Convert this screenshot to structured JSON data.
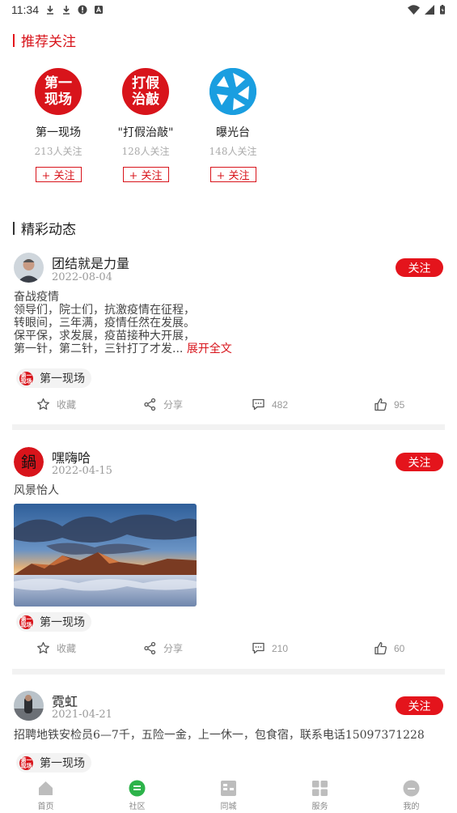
{
  "status_bar": {
    "time": "11:34"
  },
  "recommend": {
    "title": "推荐关注",
    "items": [
      {
        "name": "第一现场",
        "count": "213人关注",
        "follow_label": "+ 关注",
        "logo_line1": "第一",
        "logo_line2": "现场"
      },
      {
        "name": "\"打假治敲\"",
        "count": "128人关注",
        "follow_label": "+ 关注",
        "logo_line1": "打假",
        "logo_line2": "治敲"
      },
      {
        "name": "曝光台",
        "count": "148人关注",
        "follow_label": "+ 关注"
      }
    ]
  },
  "feed": {
    "title": "精彩动态",
    "posts": [
      {
        "user": "团结就是力量",
        "date": "2022-08-04",
        "follow_label": "关注",
        "lines": [
          "奋战疫情",
          "领导们，院士们，抗激疫情在征程，",
          "转眼间，三年满，疫情任然在发展。",
          "保平保，求发展，疫苗接种大开展，",
          "第一针，第二针，三针打了才发..."
        ],
        "expand_label": "展开全文",
        "topic": "第一现场",
        "favorite_label": "收藏",
        "share_label": "分享",
        "comments": "482",
        "likes": "95"
      },
      {
        "user": "嘿嗨哈",
        "date": "2022-04-15",
        "follow_label": "关注",
        "lines": [
          "风景怡人"
        ],
        "topic": "第一现场",
        "favorite_label": "收藏",
        "share_label": "分享",
        "comments": "210",
        "likes": "60"
      },
      {
        "user": "霓虹",
        "date": "2021-04-21",
        "follow_label": "关注",
        "lines": [
          "招聘地铁安检员6—7千，五险一金，上一休一，包食宿，联系电话15097371228"
        ],
        "topic": "第一现场"
      }
    ]
  },
  "bottom_nav": [
    {
      "label": "首页",
      "icon": "home-icon"
    },
    {
      "label": "社区",
      "icon": "community-icon"
    },
    {
      "label": "同城",
      "icon": "city-icon"
    },
    {
      "label": "服务",
      "icon": "services-icon"
    },
    {
      "label": "我的",
      "icon": "profile-icon"
    }
  ],
  "colors": {
    "accent": "#e4141c",
    "active_nav": "#2db34a",
    "blue_logo": "#1a9ee0"
  }
}
